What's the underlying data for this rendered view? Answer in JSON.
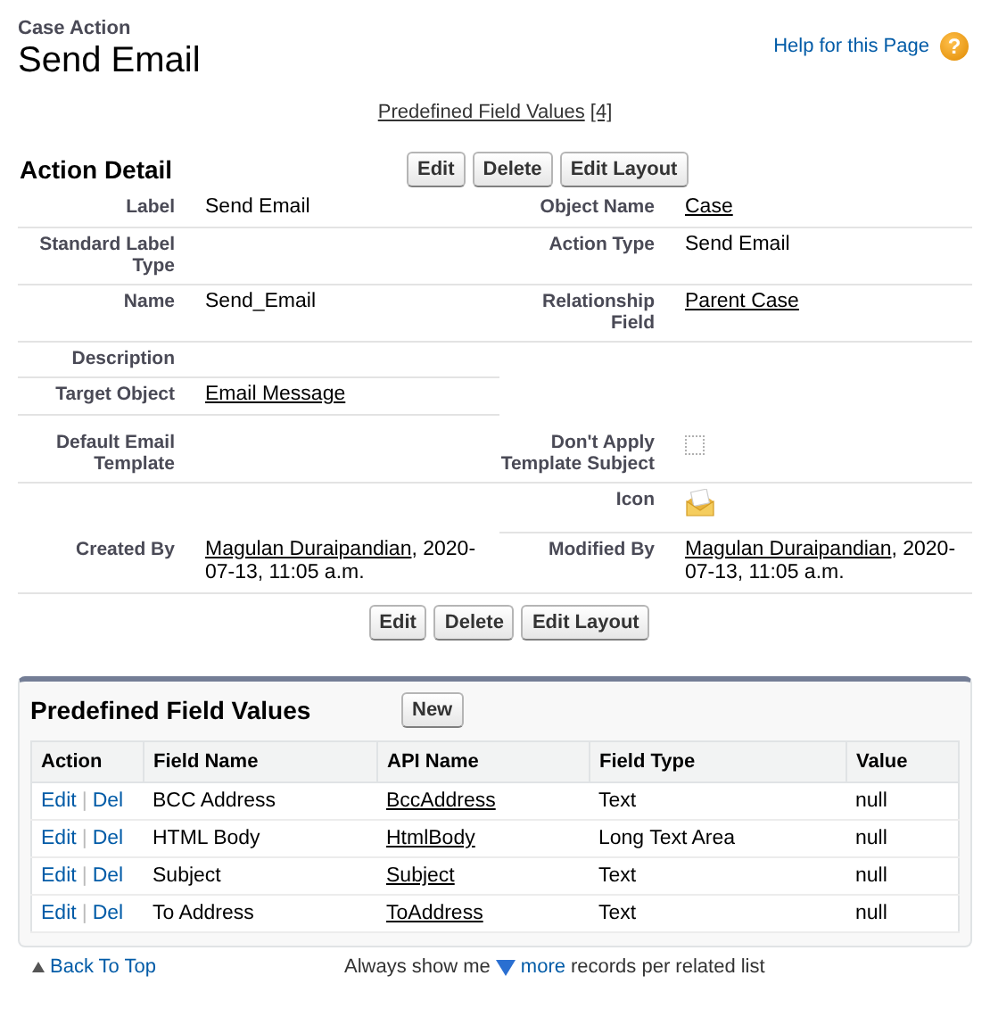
{
  "header": {
    "type_label": "Case Action",
    "title": "Send Email",
    "help": {
      "text": "Help for this Page",
      "icon": "?"
    }
  },
  "related_link": {
    "text": "Predefined Field Values",
    "count": "[4]"
  },
  "detail": {
    "title": "Action Detail",
    "buttons": [
      "Edit",
      "Delete",
      "Edit Layout"
    ],
    "rows": [
      {
        "left": {
          "label": "Label",
          "kind": "text",
          "value": "Send Email"
        },
        "right": {
          "label": "Object Name",
          "kind": "link",
          "value": "Case"
        }
      },
      {
        "left": {
          "label": "Standard Label Type",
          "kind": "text"
        },
        "right": {
          "label": "Action Type",
          "kind": "text",
          "value": "Send Email"
        }
      },
      {
        "left": {
          "label": "Name",
          "kind": "text",
          "value": "Send_Email"
        },
        "right": {
          "label": "Relationship Field",
          "kind": "link",
          "value": "Parent Case"
        }
      },
      {
        "left": {
          "label": "Description",
          "kind": "text"
        }
      },
      {
        "left": {
          "label": "Target Object",
          "kind": "link",
          "value": "Email Message"
        }
      },
      {
        "left": {
          "label": "Default Email Template",
          "kind": "text"
        },
        "right": {
          "label": "Don't Apply Template Subject",
          "kind": "checkbox",
          "checked": false
        }
      },
      {
        "right": {
          "label": "Icon",
          "kind": "icon"
        }
      },
      {
        "left": {
          "label": "Created By",
          "kind": "user",
          "user": "Magulan Duraipandian",
          "value": ", 2020-07-13, 11:05 a.m."
        },
        "right": {
          "label": "Modified By",
          "kind": "user",
          "user": "Magulan Duraipandian",
          "value": ", 2020-07-13, 11:05 a.m."
        }
      }
    ],
    "bottom_buttons": [
      "Edit",
      "Delete",
      "Edit Layout"
    ]
  },
  "related_list": {
    "title": "Predefined Field Values",
    "button": "New",
    "columns": [
      "Action",
      "Field Name",
      "API Name",
      "Field Type",
      "Value"
    ],
    "rows": [
      {
        "actions": [
          "Edit",
          "Del"
        ],
        "separator": "|",
        "field_name": "BCC Address",
        "api_name": "BccAddress",
        "field_type": "Text",
        "value": "null"
      },
      {
        "actions": [
          "Edit",
          "Del"
        ],
        "separator": "|",
        "field_name": "HTML Body",
        "api_name": "HtmlBody",
        "field_type": "Long Text Area",
        "value": "null"
      },
      {
        "actions": [
          "Edit",
          "Del"
        ],
        "separator": "|",
        "field_name": "Subject",
        "api_name": "Subject",
        "field_type": "Text",
        "value": "null"
      },
      {
        "actions": [
          "Edit",
          "Del"
        ],
        "separator": "|",
        "field_name": "To Address",
        "api_name": "ToAddress",
        "field_type": "Text",
        "value": "null"
      }
    ]
  },
  "footer": {
    "back_to_top": "Back To Top",
    "show_prefix": "Always show me",
    "more": "more",
    "show_suffix": "records per related list"
  }
}
